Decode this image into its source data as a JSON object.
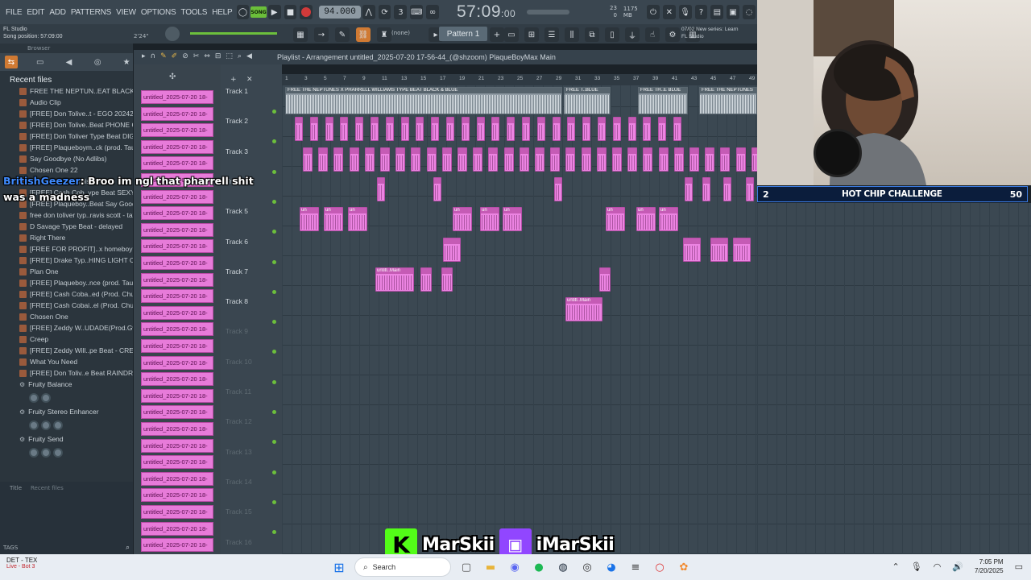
{
  "menu": [
    "FILE",
    "EDIT",
    "ADD",
    "PATTERNS",
    "VIEW",
    "OPTIONS",
    "TOOLS",
    "HELP"
  ],
  "transport": {
    "song_label": "SONG",
    "tempo": "94.000",
    "clock_main": "57:09",
    "clock_sub": ":00",
    "cpu": "23",
    "mem": "1175 MB",
    "poly": "0"
  },
  "toolbar2": {
    "app_name": "FL Studio",
    "song_position_label": "Song position: 57:09:00",
    "time_small": "2'24\"",
    "none_label": "(none)",
    "pattern_label": "Pattern 1",
    "news_line1": "07/02  New series: Learn",
    "news_line2": "FL Studio"
  },
  "browser": {
    "header": "Browser",
    "recent_title": "Recent files",
    "files": [
      "FREE THE NEPTUN..EAT BLACK & BLUE",
      "Audio Clip",
      "[FREE] Don Tolive..t - EGO  20242025",
      "[FREE] Don Tolive..Beat  PHONE CALL",
      "[FREE] Don Toliver Type Beat  DIGITAL",
      "[FREE] Plaqueboym..ck (prod. Taurs)",
      "Say Goodbye (No Adlibs)",
      "Chosen One 22",
      "Cash Cob...ing This",
      "[FREE] Cash Cob..ype Beat SEXY GYAL",
      "[FREE] Plaqueboy..Beat Say Goodbye",
      "free don toliver typ..ravis scott - taxes",
      "D Savage Type Beat - delayed",
      "Right There",
      "[FREE FOR PROFIT]..x homeboymifty ]",
      "[FREE] Drake Typ..HING LIGHT  CEDES",
      "Plan One",
      "[FREE] Plaqueboy..nce (prod. Taurs)",
      "[FREE] Cash Coba..ed (Prod. Chubbs)",
      "[FREE] Cash Cobai..el (Prod. Chubbs)",
      "Chosen One",
      "[FREE] Zeddy W..UDADE(Prod.Gwxap)",
      "Creep",
      "[FREE] Zeddy Will..pe Beat - CREEPIN",
      "What You Need",
      "[FREE] Don Toliv..e Beat  RAINDROPS"
    ],
    "plugins": [
      "Fruity Balance",
      "Fruity Stereo Enhancer",
      "Fruity Send"
    ],
    "footer_title": "Title",
    "footer_recent": "Recent files",
    "tags_label": "TAGS"
  },
  "chat": {
    "user": "BritishGeezer",
    "message": ": Broo im ngl that pharrell shit was a madness"
  },
  "playlist": {
    "title": "Playlist - Arrangement  untitled_2025-07-20 17-56-44_(@shzoom) PlaqueBoyMax Main",
    "pattern_name": "untitled_2025-07-20 18-",
    "tracks": [
      "Track 1",
      "Track 2",
      "Track 3",
      "Track 4",
      "Track 5",
      "Track 6",
      "Track 7",
      "Track 8",
      "Track 9",
      "Track 10",
      "Track 11",
      "Track 12",
      "Track 13",
      "Track 14",
      "Track 15",
      "Track 16"
    ],
    "ticks": [
      "1",
      "3",
      "5",
      "7",
      "9",
      "11",
      "13",
      "15",
      "17",
      "19",
      "21",
      "23",
      "25",
      "27",
      "29",
      "31",
      "33",
      "35",
      "37",
      "39",
      "41",
      "43",
      "45",
      "47",
      "49"
    ],
    "audio_labels": [
      "FREE THE NEPTUNES X PHARRELL WILLIAMS TYPE BEAT BLACK & BLUE",
      "FREE T..BLUE",
      "FREE TH..E BLUE",
      "FREE THE NEPTUNES"
    ],
    "clip_label_un": "un",
    "clip_label_main": "untitl..Main",
    "clip_label_untitled": "untitl..Main"
  },
  "challenge": {
    "number": "2",
    "title": "HOT CHIP CHALLENGE",
    "count": "50"
  },
  "social": {
    "kick_name": "MarSkii",
    "twitch_name": "iMarSkii"
  },
  "taskbar": {
    "weather_title": "DET - TEX",
    "weather_sub": "Live - Bot 3",
    "search_label": "Search",
    "time": "7:05 PM",
    "date": "7/20/2025"
  },
  "colors": {
    "pattern_pink": "#e77bd9",
    "accent_orange": "#d07a33",
    "kick_green": "#53fc18",
    "twitch_purple": "#9146ff",
    "challenge_bg": "#0b1d3c"
  }
}
